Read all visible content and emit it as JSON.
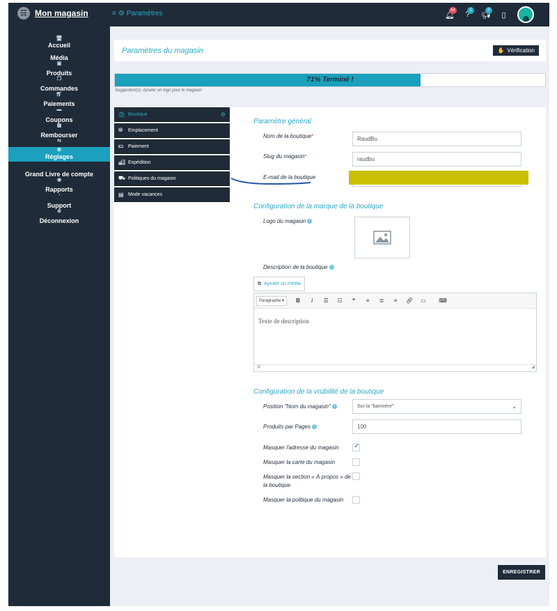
{
  "brand": {
    "logo_text": "☷",
    "name": "Mon magasin"
  },
  "breadcrumb": {
    "glyph": "≡",
    "icon": "gears-icon",
    "label": "Paramètres"
  },
  "top_icons": [
    {
      "name": "bell-icon",
      "glyph": "🔔︎",
      "badge": "44"
    },
    {
      "name": "help-icon",
      "glyph": "?",
      "badge": "1"
    },
    {
      "name": "megaphone-icon",
      "glyph": "📢︎",
      "badge": "0"
    },
    {
      "name": "tablet-icon",
      "glyph": "▯",
      "badge": ""
    }
  ],
  "sidebar": {
    "items": [
      {
        "label": "Accueil",
        "icon": "🖥︎"
      },
      {
        "label": "Média",
        "icon": "▣"
      },
      {
        "label": "Produits",
        "icon": "❒"
      },
      {
        "label": "Commandes",
        "icon": "🛒︎"
      },
      {
        "label": "Paiements",
        "icon": "▬"
      },
      {
        "label": "Coupons",
        "icon": "▦"
      },
      {
        "label": "Rembourser",
        "icon": "⇆"
      },
      {
        "label": "Réglages",
        "icon": "⚙"
      },
      {
        "label": "Grand Livre de compte",
        "icon": "◉"
      },
      {
        "label": "Rapports",
        "icon": "◔"
      },
      {
        "label": "Support",
        "icon": "⊕"
      },
      {
        "label": "Déconnexion",
        "icon": "⏻"
      }
    ]
  },
  "header": {
    "title": "Paramètres du magasin",
    "verify_label": "Vérification",
    "verify_icon": "✋"
  },
  "progress": {
    "text": "71% Terminé !",
    "percent": 71
  },
  "suggestion": "Suggestion(s): Ajouter un logo pour le magasin",
  "tabs": [
    {
      "label": "Boutique",
      "icon": "🛍︎"
    },
    {
      "label": "Emplacement",
      "icon": "🌐︎"
    },
    {
      "label": "Paiement",
      "icon": "💵︎"
    },
    {
      "label": "Expédition",
      "icon": "🚚︎"
    },
    {
      "label": "Politiques du magasin",
      "icon": "⛟"
    },
    {
      "label": "Mode vacances",
      "icon": "▤"
    }
  ],
  "general": {
    "title": "Paramètre général",
    "name_label": "Nom de la boutique",
    "name_value": "RaudBu",
    "slug_label": "Slug du magasin",
    "slug_value": "raudbu",
    "email_label": "E-mail de la boutique",
    "required_mark": "*"
  },
  "brand_config": {
    "title": "Configuration de la marque de la boutique",
    "logo_label": "Logo du magasin",
    "desc_label": "Description de la boutique",
    "add_media_label": "Ajouter un média",
    "info": "i"
  },
  "editor": {
    "format_select": "Paragraphe ▾",
    "toolbar": [
      {
        "name": "bold-icon",
        "glyph": "B"
      },
      {
        "name": "italic-icon",
        "glyph": "I"
      },
      {
        "name": "bullet-list-icon",
        "glyph": "☰"
      },
      {
        "name": "numbered-list-icon",
        "glyph": "☷"
      },
      {
        "name": "quote-icon",
        "glyph": "❝"
      },
      {
        "name": "align-left-icon",
        "glyph": "≡"
      },
      {
        "name": "align-center-icon",
        "glyph": "≣"
      },
      {
        "name": "align-right-icon",
        "glyph": "≡"
      },
      {
        "name": "link-icon",
        "glyph": "🔗︎"
      },
      {
        "name": "read-more-icon",
        "glyph": "▭"
      },
      {
        "name": "keyboard-icon",
        "glyph": "⌨"
      }
    ],
    "placeholder": "Texte de description",
    "footer_tag": "P"
  },
  "visibility": {
    "title": "Configuration de la visibilité de la boutique",
    "position_label": "Position \"Nom du magasin\"",
    "position_value": "Sur la \"bannière\"",
    "per_page_label": "Produits par Pages",
    "per_page_value": "100",
    "checks": [
      {
        "label": "Masquer l'adresse du magasin",
        "checked": true
      },
      {
        "label": "Masquer la carte du magasin",
        "checked": false
      },
      {
        "label": "Masquer la section « À propos » de la boutique",
        "checked": false
      },
      {
        "label": "Masquer la politique du magasin",
        "checked": false
      }
    ]
  },
  "save_label": "ENREGISTRER",
  "colors": {
    "sidebar": "#1f2b38",
    "accent": "#1ba0bd",
    "redaction": "#c9c003"
  }
}
